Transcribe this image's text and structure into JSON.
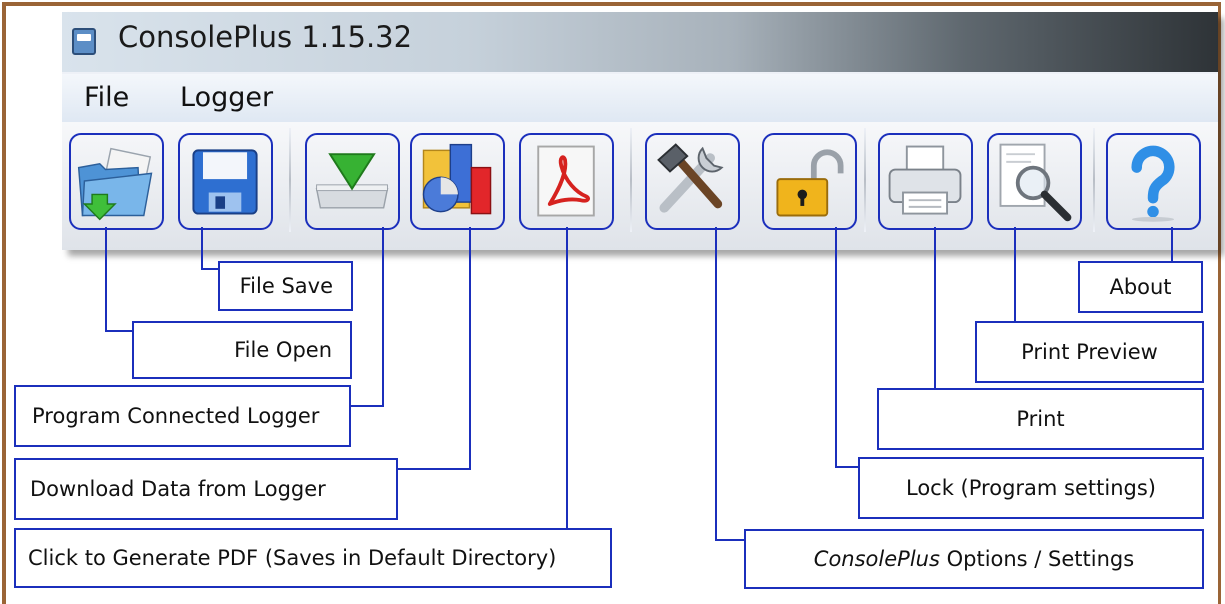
{
  "window": {
    "title": "ConsolePlus 1.15.32",
    "app_icon": "app-icon"
  },
  "menu": {
    "items": [
      "File",
      "Logger"
    ]
  },
  "toolbar": {
    "buttons": [
      {
        "id": "file-open",
        "icon": "folder-open-icon"
      },
      {
        "id": "file-save",
        "icon": "floppy-disk-icon"
      },
      {
        "id": "program-logger",
        "icon": "green-arrow-down-icon"
      },
      {
        "id": "download-data",
        "icon": "chart-icon"
      },
      {
        "id": "generate-pdf",
        "icon": "pdf-icon"
      },
      {
        "id": "options",
        "icon": "tools-icon"
      },
      {
        "id": "lock",
        "icon": "unlock-padlock-icon"
      },
      {
        "id": "print",
        "icon": "printer-icon"
      },
      {
        "id": "print-preview",
        "icon": "print-preview-icon"
      },
      {
        "id": "about",
        "icon": "help-question-icon"
      }
    ]
  },
  "callouts": {
    "file_save": "File Save",
    "file_open": "File Open",
    "program_logger": "Program Connected Logger",
    "download_data": "Download Data from Logger",
    "generate_pdf": "Click to Generate PDF (Saves in Default Directory)",
    "about": "About",
    "print_preview": "Print Preview",
    "print": "Print",
    "lock": "Lock (Program settings)",
    "options_em": "ConsolePlus",
    "options_rest": " Options / Settings"
  },
  "colors": {
    "callout_border": "#1b2fbc",
    "frame": "#9a6436"
  }
}
